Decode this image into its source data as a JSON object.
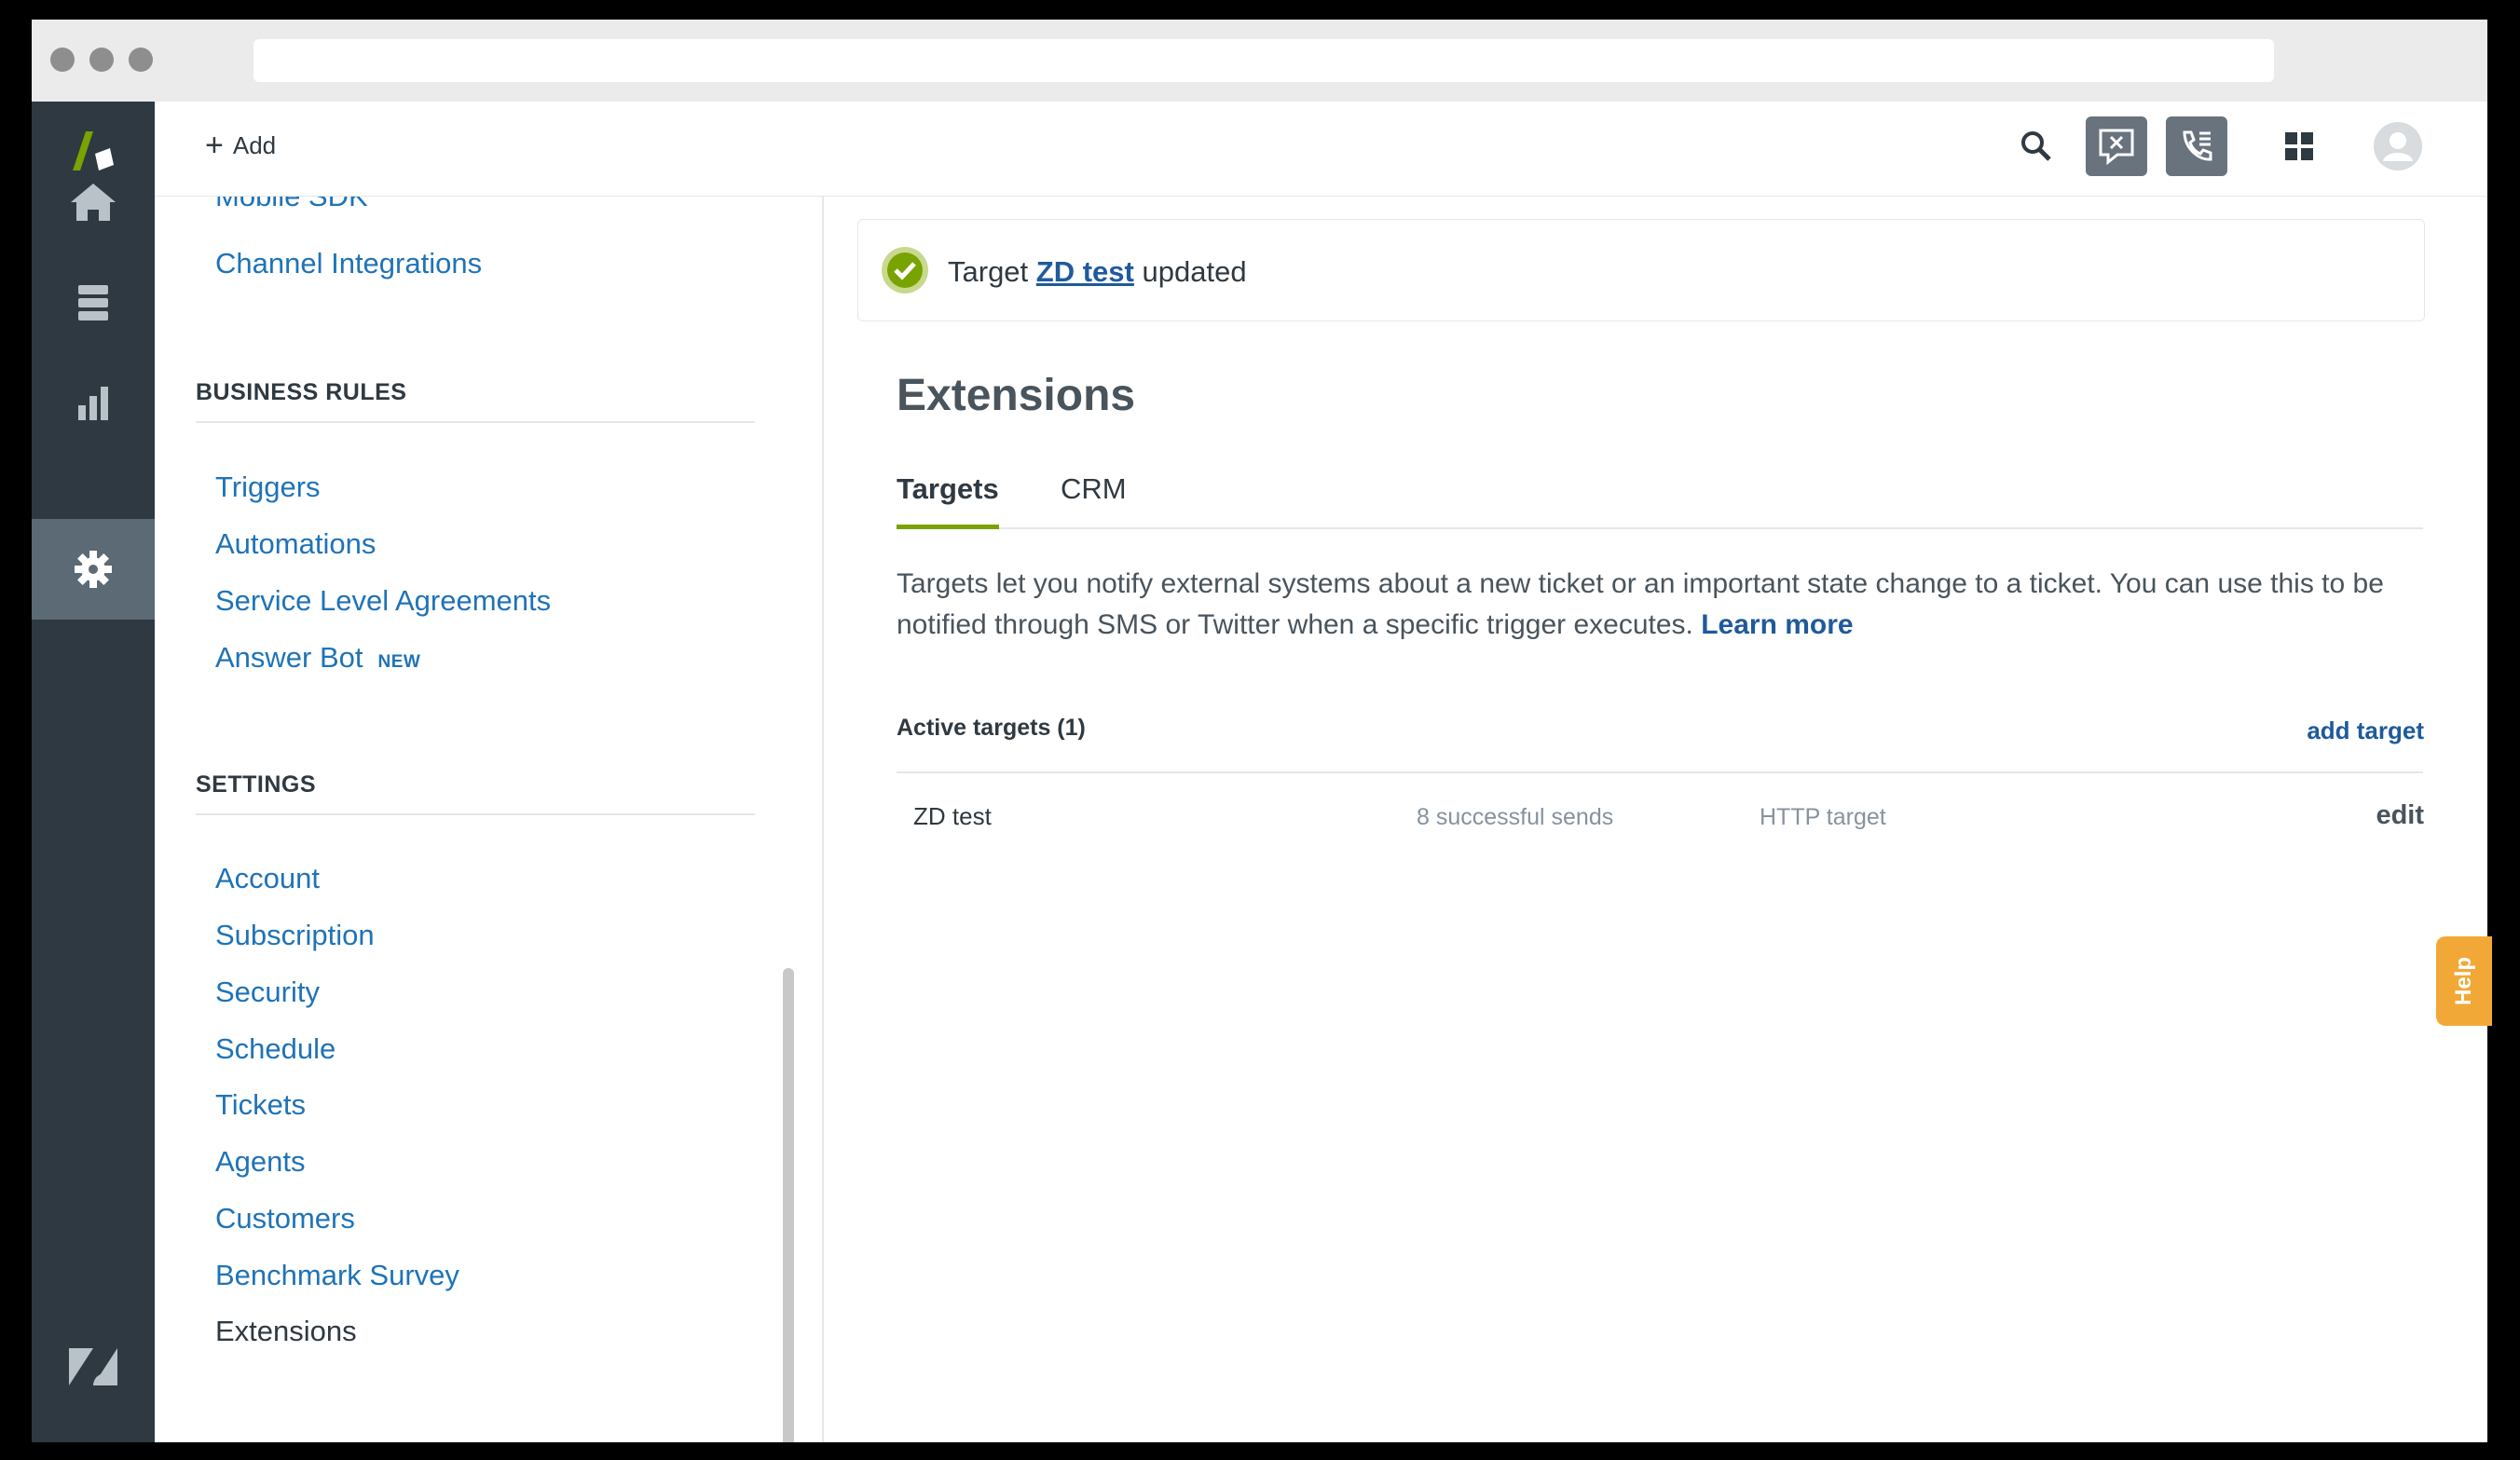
{
  "app": {
    "brand": "Zendesk",
    "accent": "#78a300",
    "link_color": "#1f73b7"
  },
  "topbar": {
    "add_label": "Add"
  },
  "sidebar": {
    "cut_off_item": "Mobile SDK",
    "top_items": [
      {
        "label": "Channel Integrations"
      }
    ],
    "business_rules": {
      "heading": "BUSINESS RULES",
      "items": [
        {
          "label": "Triggers"
        },
        {
          "label": "Automations"
        },
        {
          "label": "Service Level Agreements"
        },
        {
          "label": "Answer Bot",
          "badge": "NEW"
        }
      ]
    },
    "settings": {
      "heading": "SETTINGS",
      "items": [
        {
          "label": "Account"
        },
        {
          "label": "Subscription"
        },
        {
          "label": "Security"
        },
        {
          "label": "Schedule"
        },
        {
          "label": "Tickets"
        },
        {
          "label": "Agents"
        },
        {
          "label": "Customers"
        },
        {
          "label": "Benchmark Survey"
        },
        {
          "label": "Extensions",
          "active": true
        }
      ]
    }
  },
  "toast": {
    "prefix": "Target",
    "link": "ZD test",
    "suffix": "updated"
  },
  "main": {
    "title": "Extensions",
    "tabs": [
      {
        "label": "Targets",
        "active": true
      },
      {
        "label": "CRM"
      }
    ],
    "description": "Targets let you notify external systems about a new ticket or an important state change to a ticket. You can use this to be notified through SMS or Twitter when a specific trigger executes.",
    "learn_more": "Learn more",
    "active_heading": "Active targets (1)",
    "add_target": "add target",
    "targets": [
      {
        "name": "ZD test",
        "sends": "8 successful sends",
        "type": "HTTP target",
        "action": "edit"
      }
    ]
  },
  "help_label": "Help"
}
